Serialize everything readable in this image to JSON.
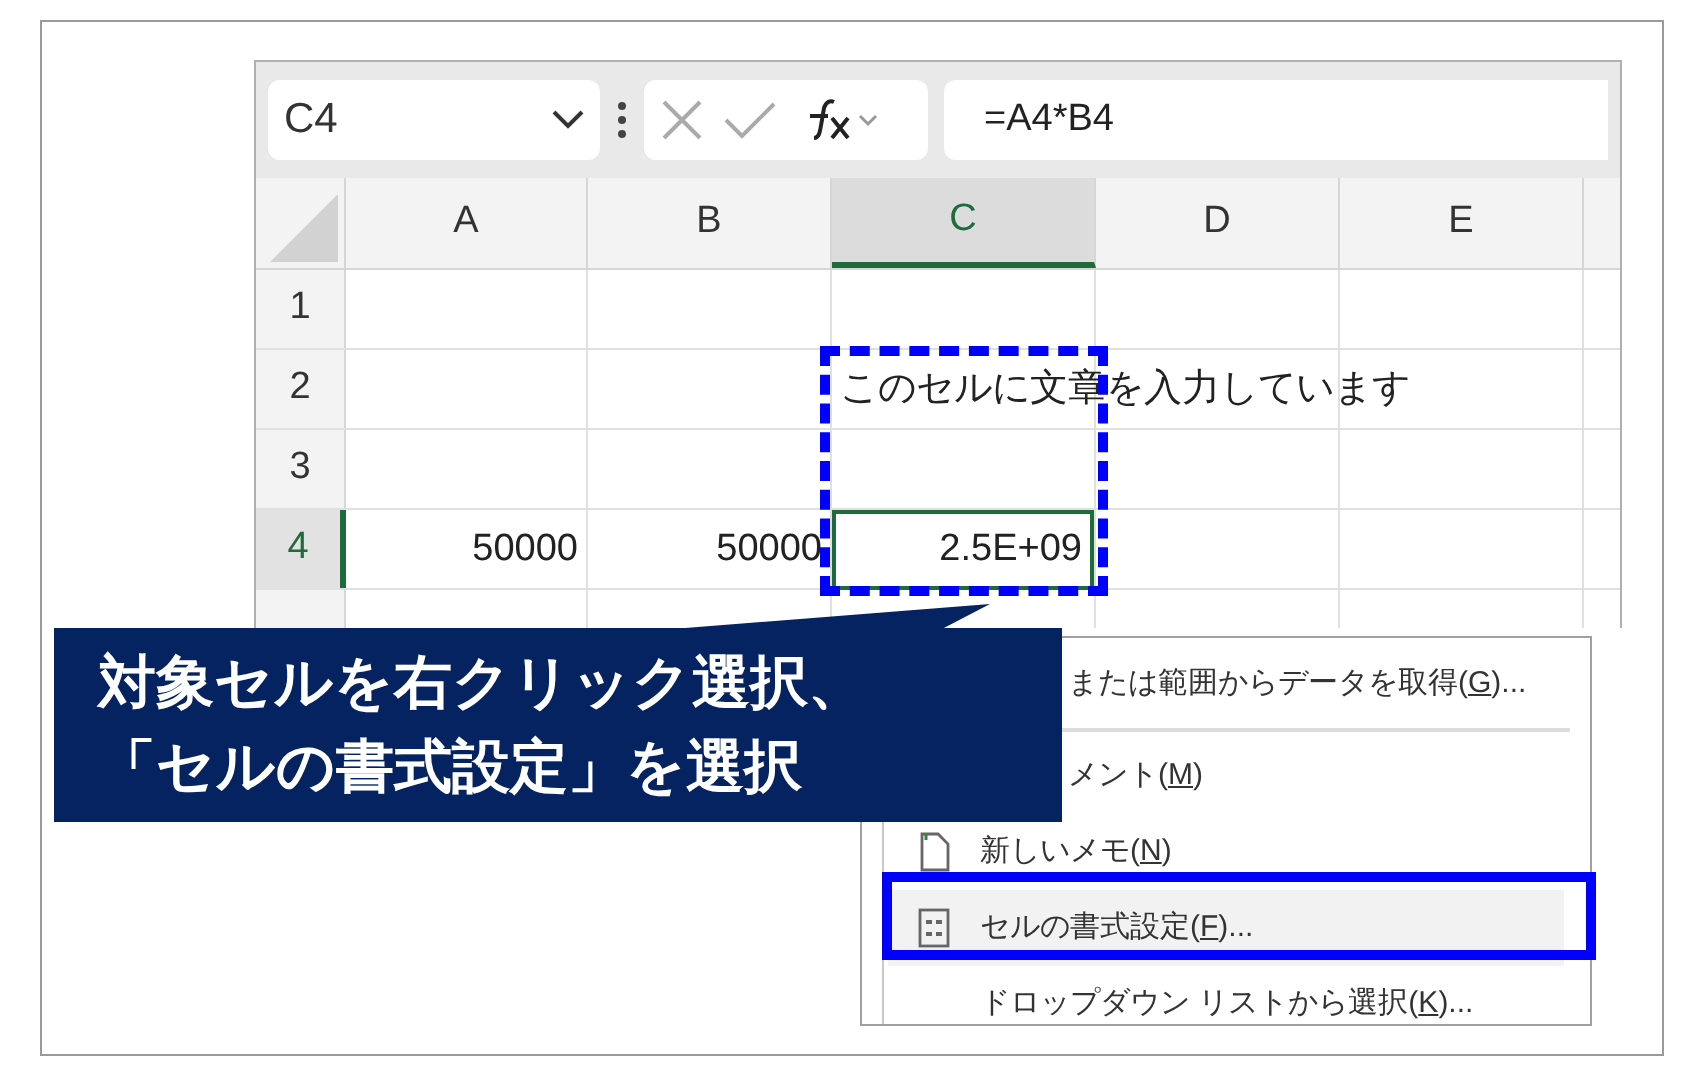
{
  "formula_bar": {
    "name_box": "C4",
    "formula": "=A4*B4"
  },
  "columns": [
    {
      "label": "A",
      "selected": false
    },
    {
      "label": "B",
      "selected": false
    },
    {
      "label": "C",
      "selected": true
    },
    {
      "label": "D",
      "selected": false
    },
    {
      "label": "E",
      "selected": false
    }
  ],
  "rows": [
    {
      "label": "1",
      "selected": false,
      "cells": []
    },
    {
      "label": "2",
      "selected": false,
      "cells": [
        null,
        null,
        {
          "kind": "text",
          "text": "このセルに文章を入力しています",
          "selected": false
        }
      ]
    },
    {
      "label": "3",
      "selected": false,
      "cells": []
    },
    {
      "label": "4",
      "selected": true,
      "cells": [
        {
          "kind": "number",
          "text": "50000",
          "selected": false
        },
        {
          "kind": "number",
          "text": "50000",
          "selected": false
        },
        {
          "kind": "number",
          "text": "2.5E+09",
          "selected": true
        }
      ]
    },
    {
      "selected": false,
      "cells": []
    }
  ],
  "context_menu": [
    {
      "kind": "covered",
      "before": "または範囲からデータを取得(",
      "key": "G",
      "after": ")...",
      "selected": false
    },
    {
      "kind": "separator"
    },
    {
      "kind": "covered",
      "before": "メント(",
      "key": "M",
      "after": ")",
      "selected": false
    },
    {
      "kind": "note",
      "before": "新しいメモ(",
      "key": "N",
      "after": ")",
      "selected": false
    },
    {
      "kind": "format",
      "before": "セルの書式設定(",
      "key": "F",
      "after": ")...",
      "selected": true
    },
    {
      "kind": "item",
      "before": "ドロップダウン リストから選択(",
      "key": "K",
      "after": ")...",
      "selected": false
    }
  ],
  "callout": {
    "lines": [
      "対象セルを右クリック選択、",
      "「セルの書式設定」を選択"
    ]
  }
}
